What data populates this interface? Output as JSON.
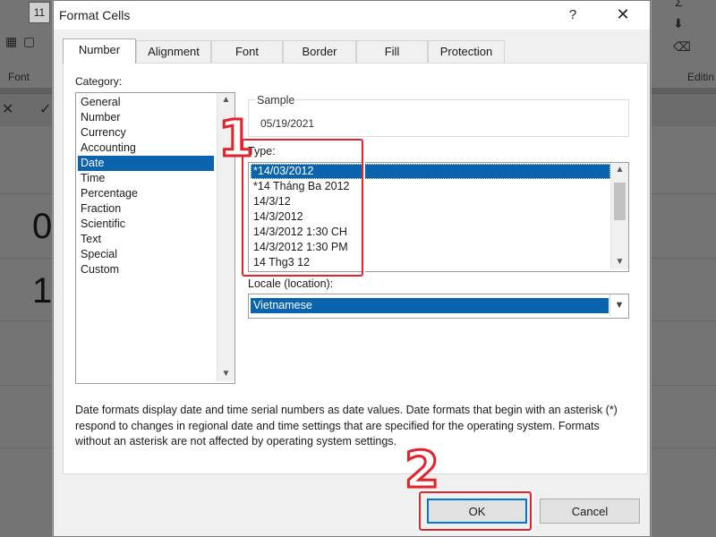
{
  "excel": {
    "font_size": "11",
    "ribbon_font_label": "Font",
    "ribbon_editing_label": "Editin",
    "cell_digits": [
      "0",
      "1"
    ]
  },
  "dialog": {
    "title": "Format Cells",
    "help": "?",
    "close": "✕",
    "tabs": [
      "Number",
      "Alignment",
      "Font",
      "Border",
      "Fill",
      "Protection"
    ],
    "active_tab": "Number",
    "category": {
      "label": "Category:",
      "items": [
        "General",
        "Number",
        "Currency",
        "Accounting",
        "Date",
        "Time",
        "Percentage",
        "Fraction",
        "Scientific",
        "Text",
        "Special",
        "Custom"
      ],
      "selected": "Date"
    },
    "sample": {
      "label": "Sample",
      "value": "05/19/2021"
    },
    "type": {
      "label": "Type:",
      "items": [
        "*14/03/2012",
        "*14 Tháng Ba 2012",
        "14/3/12",
        "14/3/2012",
        "14/3/2012 1:30 CH",
        "14/3/2012 1:30 PM",
        "14 Thg3 12"
      ],
      "selected": "*14/03/2012"
    },
    "locale": {
      "label": "Locale (location):",
      "value": "Vietnamese"
    },
    "description": "Date formats display date and time serial numbers as date values.  Date formats that begin with an asterisk (*) respond to changes in regional date and time settings that are specified for the operating system. Formats without an asterisk are not affected by operating system settings.",
    "ok": "OK",
    "cancel": "Cancel"
  },
  "annotations": {
    "step1": "1",
    "step2": "2",
    "highlight_color": "#e3232b"
  }
}
